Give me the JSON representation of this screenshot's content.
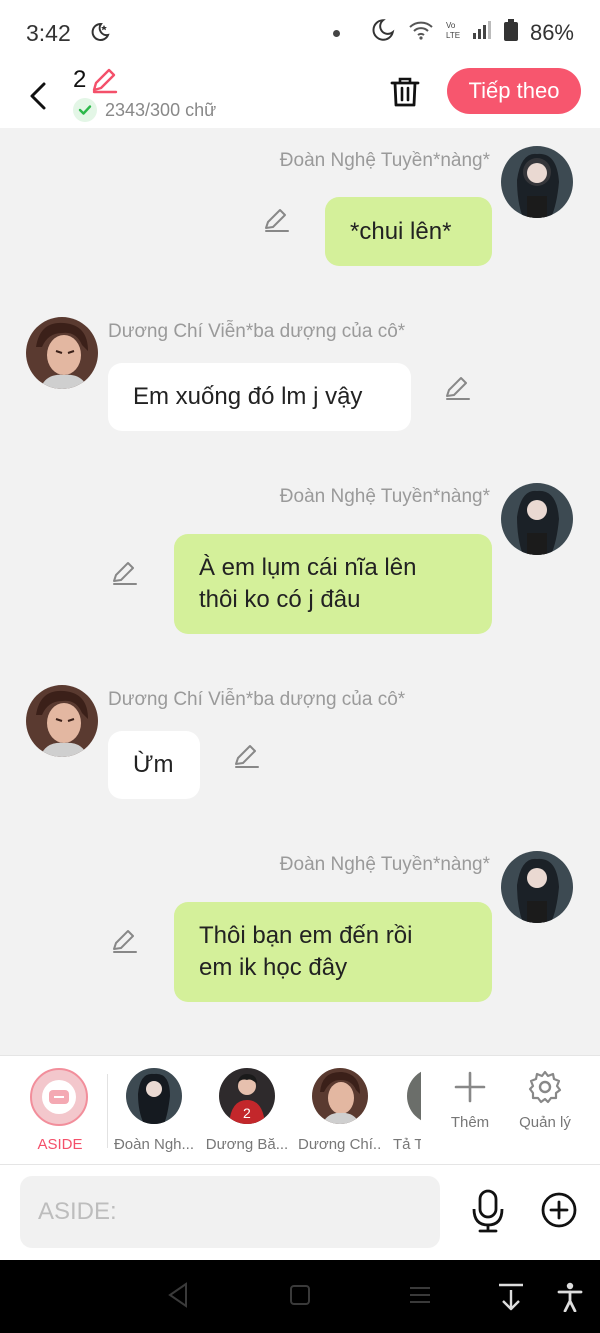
{
  "status": {
    "time": "3:42",
    "battery": "86%"
  },
  "header": {
    "count": "2",
    "word_count": "2343/300 chữ",
    "next_label": "Tiếp theo"
  },
  "messages": [
    {
      "sender": "Đoàn Nghệ Tuyền*nàng*",
      "side": "right",
      "lines": [
        "*chui lên*"
      ]
    },
    {
      "sender": "Dương Chí Viễn*ba dượng của cô*",
      "side": "left",
      "lines": [
        "Em xuống đó lm j vậy"
      ]
    },
    {
      "sender": "Đoàn Nghệ Tuyền*nàng*",
      "side": "right",
      "lines": [
        "À em lụm cái nĩa lên",
        "thôi ko có j đâu"
      ]
    },
    {
      "sender": "Dương Chí Viễn*ba dượng của cô*",
      "side": "left",
      "lines": [
        "Ừm"
      ]
    },
    {
      "sender": "Đoàn Nghệ Tuyền*nàng*",
      "side": "right",
      "lines": [
        "Thôi bạn em đến rồi",
        "em ik học đây"
      ]
    }
  ],
  "tray": {
    "aside_label": "ASIDE",
    "characters": [
      "Đoàn Ngh...",
      "Dương Bă...",
      "Dương Chí...",
      "Tả T"
    ],
    "add_label": "Thêm",
    "manage_label": "Quản lý"
  },
  "composer": {
    "placeholder": "ASIDE:"
  },
  "colors": {
    "accent": "#f7566e",
    "my_bubble": "#d4f09a",
    "other_bubble": "#ffffff"
  }
}
